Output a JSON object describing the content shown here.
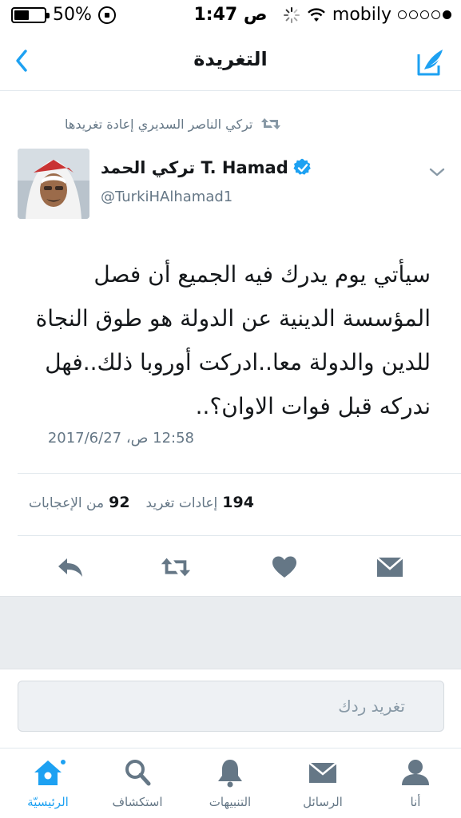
{
  "status_bar": {
    "battery": "50%",
    "battery_level": 0.5,
    "time": "1:47 ص",
    "carrier": "mobily",
    "signal_bars_filled": 1,
    "signal_bars_total": 5
  },
  "nav": {
    "title": "التغريدة",
    "back_icon": "chevron-left-icon",
    "compose_icon": "compose-tweet-icon"
  },
  "retweet": {
    "text": "تركي الناصر السديري إعادة تغريدها",
    "icon": "retweet-icon"
  },
  "author": {
    "name": "تركي الحمد T. Hamad",
    "handle": "@TurkiHAlhamad1",
    "verified": true
  },
  "tweet": {
    "lines": [
      "سيأتي يوم يدرك فيه الجميع أن فصل",
      "المؤسسة الدينية عن الدولة هو طوق النجاة",
      "للدين والدولة معا..ادركت أوروبا ذلك..فهل",
      "ندركه قبل فوات الاوان؟.."
    ],
    "timestamp": "12:58 ص، 2017/6/27"
  },
  "stats": {
    "retweets_count": "194",
    "retweets_label": "إعادات تغريد",
    "likes_count": "92",
    "likes_label": "من الإعجابات"
  },
  "actions": [
    "reply-icon",
    "retweet-icon",
    "heart-icon",
    "envelope-icon"
  ],
  "reply": {
    "placeholder": "تغريد ردك"
  },
  "tabs": [
    {
      "label": "الرئيسيّة",
      "icon": "home-icon",
      "active": true
    },
    {
      "label": "استكشاف",
      "icon": "search-icon",
      "active": false
    },
    {
      "label": "التنبيهات",
      "icon": "bell-icon",
      "active": false
    },
    {
      "label": "الرسائل",
      "icon": "envelope-icon",
      "active": false
    },
    {
      "label": "أنا",
      "icon": "person-icon",
      "active": false
    }
  ],
  "colors": {
    "accent": "#1da1f2",
    "text": "#14171a",
    "secondary": "#657786",
    "icon_gray": "#657786",
    "divider": "#e1e8ed"
  }
}
